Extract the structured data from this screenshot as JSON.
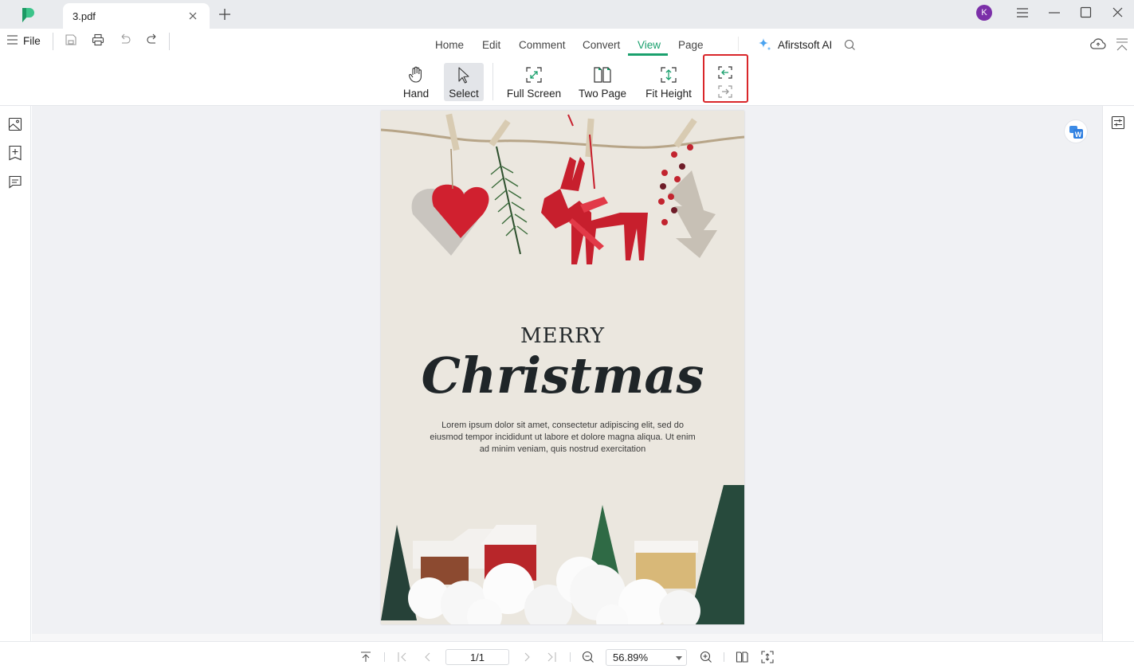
{
  "window": {
    "tab_title": "3.pdf",
    "avatar_initial": "K",
    "avatar_color": "#7b2fa8"
  },
  "quickbar": {
    "file_label": "File"
  },
  "nav": {
    "tabs": [
      {
        "label": "Home",
        "active": false
      },
      {
        "label": "Edit",
        "active": false
      },
      {
        "label": "Comment",
        "active": false
      },
      {
        "label": "Convert",
        "active": false
      },
      {
        "label": "View",
        "active": true
      },
      {
        "label": "Page",
        "active": false
      }
    ],
    "ai_label": "Afirstsoft AI",
    "accent_color": "#1aa06d"
  },
  "view_tools": {
    "hand": "Hand",
    "select": "Select",
    "full_screen": "Full Screen",
    "two_page": "Two Page",
    "fit_height": "Fit Height"
  },
  "document": {
    "merry": "MERRY",
    "christmas": "Christmas",
    "body_lines": [
      "Lorem ipsum dolor sit amet, consectetur adipiscing elit, sed do",
      "eiusmod tempor incididunt ut labore et dolore magna aliqua. Ut enim",
      "ad minim veniam, quis nostrud exercitation"
    ]
  },
  "statusbar": {
    "page_indicator": "1/1",
    "zoom_value": "56.89%"
  },
  "highlight_color": "#d9262a"
}
